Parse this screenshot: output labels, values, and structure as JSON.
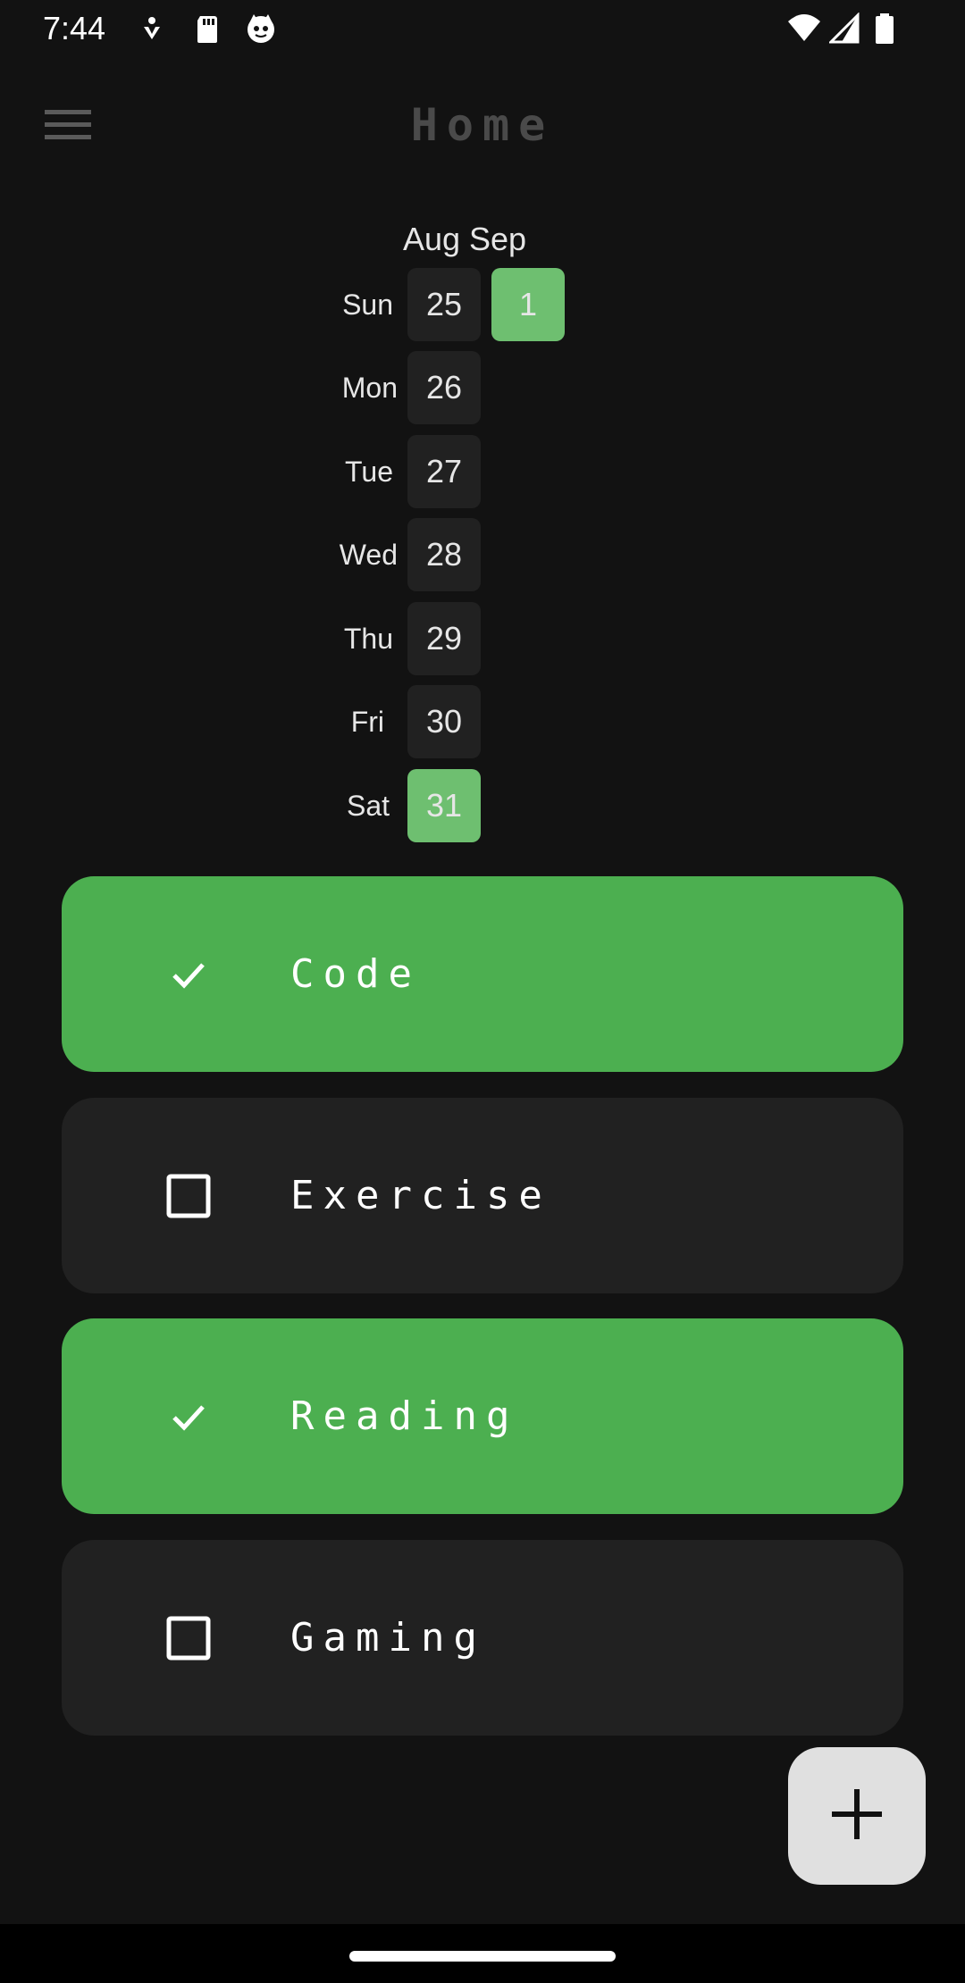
{
  "status_bar": {
    "time": "7:44",
    "left_icons": [
      "accessibility-icon",
      "sd-card-icon",
      "cat-face-icon"
    ],
    "right_icons": [
      "wifi-icon",
      "cell-signal-icon",
      "battery-icon"
    ]
  },
  "app_bar": {
    "menu_icon": "hamburger-menu-icon",
    "title": "Home"
  },
  "calendar": {
    "months": [
      "Aug",
      "Sep"
    ],
    "day_labels": [
      "Sun",
      "Mon",
      "Tue",
      "Wed",
      "Thu",
      "Fri",
      "Sat"
    ],
    "columns": [
      {
        "month": "Aug",
        "days": [
          {
            "day": "25",
            "done": false
          },
          {
            "day": "26",
            "done": false
          },
          {
            "day": "27",
            "done": false
          },
          {
            "day": "28",
            "done": false
          },
          {
            "day": "29",
            "done": false
          },
          {
            "day": "30",
            "done": false
          },
          {
            "day": "31",
            "done": true
          }
        ]
      },
      {
        "month": "Sep",
        "days": [
          {
            "day": "1",
            "done": true
          }
        ]
      }
    ],
    "colors": {
      "done": "#6ebf70",
      "empty": "#212121"
    }
  },
  "habits": [
    {
      "name": "Code",
      "done": true,
      "icon": "check-icon"
    },
    {
      "name": "Exercise",
      "done": false,
      "icon": "empty-checkbox-icon"
    },
    {
      "name": "Reading",
      "done": true,
      "icon": "check-icon"
    },
    {
      "name": "Gaming",
      "done": false,
      "icon": "empty-checkbox-icon"
    }
  ],
  "fab": {
    "icon": "plus-icon"
  },
  "colors": {
    "background": "#121212",
    "card": "#212121",
    "accent": "#4caf50",
    "fab": "#e0e0e0"
  }
}
